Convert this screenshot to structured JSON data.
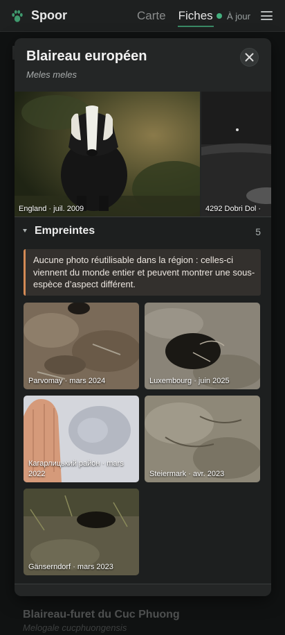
{
  "header": {
    "app_title": "Spoor",
    "tabs": [
      {
        "label": "Carte",
        "active": false
      },
      {
        "label": "Fiches",
        "active": true
      }
    ],
    "sync_status": "À jour",
    "sync_color": "#44b07f"
  },
  "background_list": {
    "next_item": {
      "title": "Blaireau-furet du Cuc Phuong",
      "scientific_name": "Melogale cucphuongensis"
    }
  },
  "detail": {
    "title": "Blaireau européen",
    "scientific_name": "Meles meles",
    "close_icon": "close-icon",
    "gallery": [
      {
        "caption": "England · juil. 2009"
      },
      {
        "caption": "4292 Dobri Dol ·"
      }
    ],
    "tracks_section": {
      "title": "Empreintes",
      "count": "5",
      "expanded": true,
      "note": "Aucune photo réutilisable dans la région : celles-ci viennent du monde entier et peuvent montrer une sous-espèce d’aspect différent.",
      "accent_color": "#d48a55",
      "photos": [
        {
          "caption": "Parvomay · mars 2024"
        },
        {
          "caption": "Luxembourg · juin 2025"
        },
        {
          "caption": "Кагарлицький район · mars 2022"
        },
        {
          "caption": "Steiermark · avr. 2023"
        },
        {
          "caption": "Gänserndorf · mars 2023"
        }
      ]
    }
  }
}
